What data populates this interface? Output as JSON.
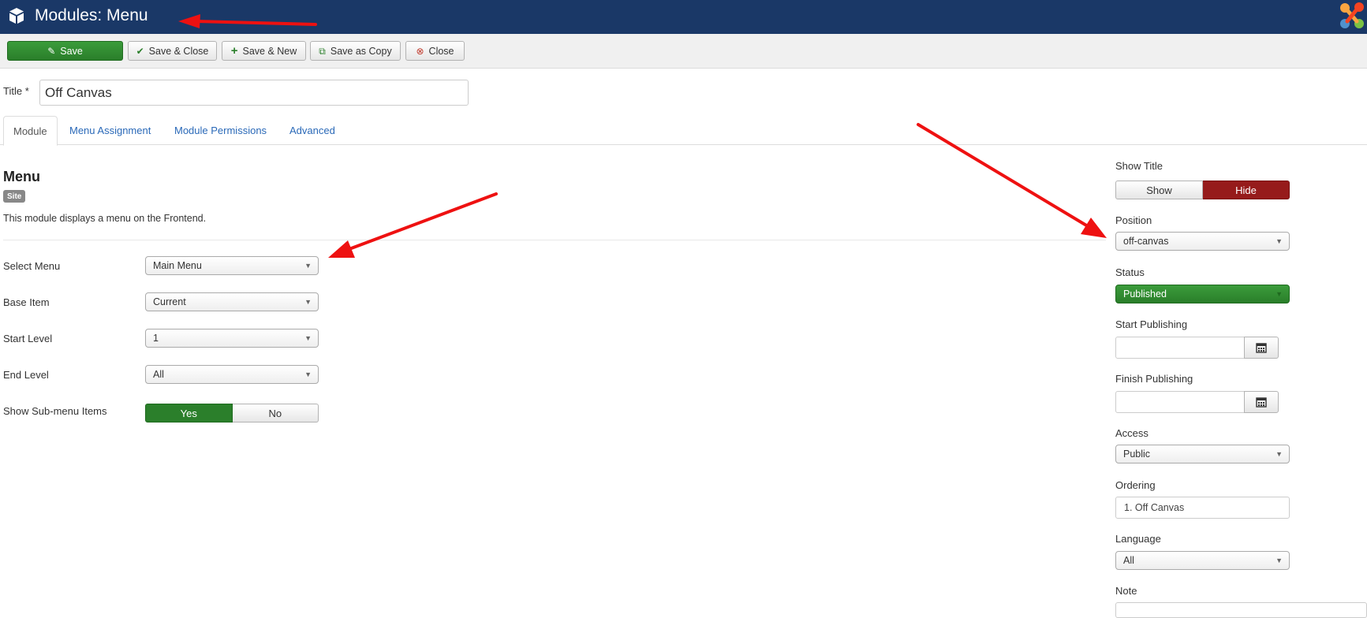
{
  "header": {
    "title": "Modules: Menu",
    "app_icon": "cube-icon",
    "logo": "joomla-logo"
  },
  "toolbar": {
    "save": "Save",
    "save_close": "Save & Close",
    "save_new": "Save & New",
    "save_copy": "Save as Copy",
    "close": "Close"
  },
  "title_field": {
    "label": "Title *",
    "value": "Off Canvas"
  },
  "tabs": [
    {
      "label": "Module",
      "active": true
    },
    {
      "label": "Menu Assignment",
      "active": false
    },
    {
      "label": "Module Permissions",
      "active": false
    },
    {
      "label": "Advanced",
      "active": false
    }
  ],
  "module": {
    "heading": "Menu",
    "badge": "Site",
    "description": "This module displays a menu on the Frontend."
  },
  "fields": {
    "select_menu": {
      "label": "Select Menu",
      "value": "Main Menu"
    },
    "base_item": {
      "label": "Base Item",
      "value": "Current"
    },
    "start_level": {
      "label": "Start Level",
      "value": "1"
    },
    "end_level": {
      "label": "End Level",
      "value": "All"
    },
    "show_submenu": {
      "label": "Show Sub-menu Items",
      "yes": "Yes",
      "no": "No",
      "selected": "Yes"
    }
  },
  "sidebar": {
    "show_title": {
      "label": "Show Title",
      "show": "Show",
      "hide": "Hide",
      "selected": "Hide"
    },
    "position": {
      "label": "Position",
      "value": "off-canvas"
    },
    "status": {
      "label": "Status",
      "value": "Published"
    },
    "start_publishing": {
      "label": "Start Publishing",
      "value": ""
    },
    "finish_publishing": {
      "label": "Finish Publishing",
      "value": ""
    },
    "access": {
      "label": "Access",
      "value": "Public"
    },
    "ordering": {
      "label": "Ordering",
      "value": "1. Off Canvas"
    },
    "language": {
      "label": "Language",
      "value": "All"
    },
    "note": {
      "label": "Note"
    }
  },
  "colors": {
    "header_bg": "#1a3867",
    "success": "#2b7f2b",
    "danger": "#961b1b",
    "link": "#2a69b8",
    "annotation_arrow": "#ee1111"
  }
}
